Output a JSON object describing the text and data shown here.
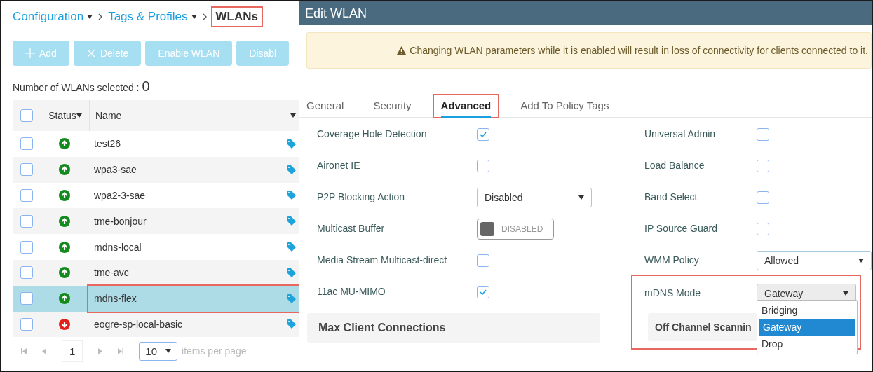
{
  "breadcrumb": [
    {
      "label": "Configuration",
      "kind": "menu",
      "highlighted": false
    },
    {
      "label": "Tags & Profiles",
      "kind": "menu",
      "highlighted": false
    },
    {
      "label": "WLANs",
      "kind": "current",
      "highlighted": true
    }
  ],
  "toolbar": [
    {
      "label": "Add",
      "kind": "plus"
    },
    {
      "label": "Delete",
      "kind": "close"
    },
    {
      "label": "Enable WLAN",
      "kind": "plain"
    },
    {
      "label": "Disabl",
      "kind": "plain"
    }
  ],
  "selection_count": {
    "label": "Number of WLANs selected :",
    "value": "0"
  },
  "table": {
    "header_checked": false,
    "columns": [
      "Status",
      "Name"
    ],
    "rows": [
      {
        "checked": false,
        "kind": "up",
        "name": "test26",
        "selected": false,
        "highlighted": false
      },
      {
        "checked": false,
        "kind": "up",
        "name": "wpa3-sae",
        "selected": false,
        "highlighted": false
      },
      {
        "checked": false,
        "kind": "up",
        "name": "wpa2-3-sae",
        "selected": false,
        "highlighted": false
      },
      {
        "checked": false,
        "kind": "up",
        "name": "tme-bonjour",
        "selected": false,
        "highlighted": false
      },
      {
        "checked": false,
        "kind": "up",
        "name": "mdns-local",
        "selected": false,
        "highlighted": false
      },
      {
        "checked": false,
        "kind": "up",
        "name": "tme-avc",
        "selected": false,
        "highlighted": false
      },
      {
        "checked": false,
        "kind": "up",
        "name": "mdns-flex",
        "selected": true,
        "highlighted": true
      },
      {
        "checked": false,
        "kind": "down",
        "name": "eogre-sp-local-basic",
        "selected": false,
        "highlighted": false
      }
    ]
  },
  "pagination": {
    "page": "1",
    "page_size": "10",
    "suffix": "items per page"
  },
  "edit_panel": {
    "title": "Edit WLAN",
    "warning": "Changing WLAN parameters while it is enabled will result in loss of connectivity for clients connected to it.",
    "tabs": [
      {
        "label": "General",
        "selected": false,
        "highlighted": false
      },
      {
        "label": "Security",
        "selected": false,
        "highlighted": false
      },
      {
        "label": "Advanced",
        "selected": true,
        "highlighted": true
      },
      {
        "label": "Add To Policy Tags",
        "selected": false,
        "highlighted": false
      }
    ],
    "left_settings": [
      {
        "label": "Coverage Hole Detection",
        "kind": "checkbox",
        "checked": true
      },
      {
        "label": "Aironet IE",
        "kind": "checkbox",
        "checked": false
      },
      {
        "label": "P2P Blocking Action",
        "kind": "select",
        "value": "Disabled"
      },
      {
        "label": "Multicast Buffer",
        "kind": "toggle",
        "on": false,
        "value": "DISABLED"
      },
      {
        "label": "Media Stream Multicast-direct",
        "kind": "checkbox",
        "checked": false
      },
      {
        "label": "11ac MU-MIMO",
        "kind": "checkbox",
        "checked": true
      }
    ],
    "left_section": "Max Client Connections",
    "right_settings": [
      {
        "label": "Universal Admin",
        "kind": "checkbox",
        "checked": false
      },
      {
        "label": "Load Balance",
        "kind": "checkbox",
        "checked": false
      },
      {
        "label": "Band Select",
        "kind": "checkbox",
        "checked": false
      },
      {
        "label": "IP Source Guard",
        "kind": "checkbox",
        "checked": false
      },
      {
        "label": "WMM Policy",
        "kind": "select",
        "value": "Allowed"
      }
    ],
    "mdns": {
      "label": "mDNS Mode",
      "value": "Gateway",
      "expanded": true,
      "highlighted": true,
      "options": [
        {
          "label": "Bridging",
          "selected": false
        },
        {
          "label": "Gateway",
          "selected": true
        },
        {
          "label": "Drop",
          "selected": false
        }
      ]
    },
    "right_section": "Off Channel Scannin"
  }
}
